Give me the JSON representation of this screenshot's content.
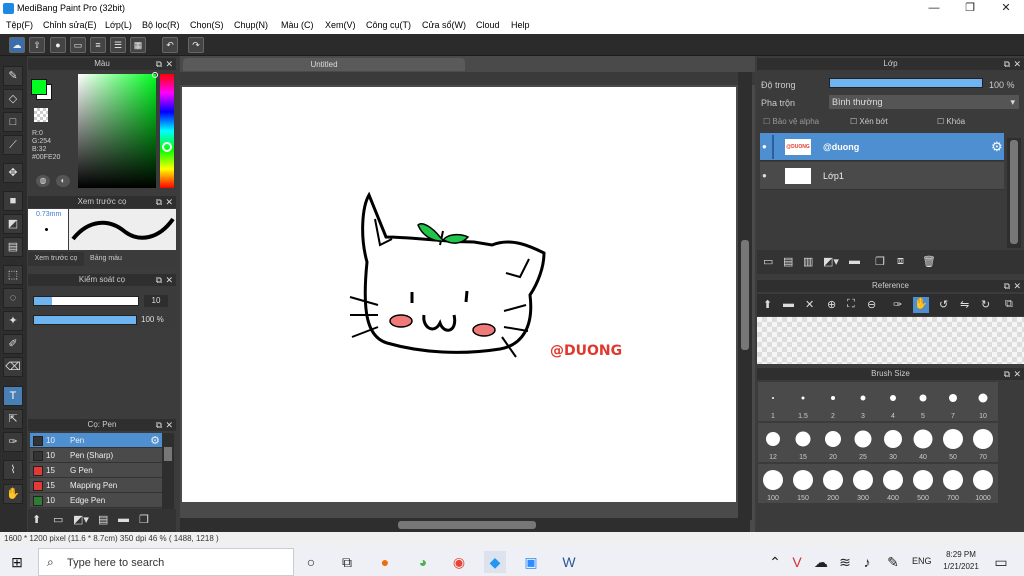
{
  "window": {
    "title": "MediBang Paint Pro (32bit)",
    "minimize": "—",
    "maximize": "❐",
    "close": "✕"
  },
  "menu": [
    "Tệp(F)",
    "Chỉnh sửa(E)",
    "Lớp(L)",
    "Bộ lọc(R)",
    "Chọn(S)",
    "Chụp(N)",
    "Màu (C)",
    "Xem(V)",
    "Công cụ(T)",
    "Cửa sổ(W)",
    "Cloud",
    "Help"
  ],
  "color_panel": {
    "title": "Màu",
    "r": "R:0",
    "g": "G:254",
    "b": "B:32",
    "hex": "#00FE20",
    "fg": "#00fe20",
    "bg": "#ffffff"
  },
  "brush_preview": {
    "title": "Xem trước cọ",
    "size": "0.73mm",
    "tab1": "Xem trước cọ",
    "tab2": "Bảng màu"
  },
  "brush_control": {
    "title": "Kiểm soát cọ",
    "size": "10",
    "opacity": "100 %",
    "opacity_fraction": 1.0
  },
  "brush_list": {
    "title": "Cọ: Pen",
    "items": [
      {
        "size": "10",
        "name": "Pen",
        "color": "#333333"
      },
      {
        "size": "10",
        "name": "Pen (Sharp)",
        "color": "#333333"
      },
      {
        "size": "15",
        "name": "G Pen",
        "color": "#e53935"
      },
      {
        "size": "15",
        "name": "Mapping Pen",
        "color": "#e53935"
      },
      {
        "size": "10",
        "name": "Edge Pen",
        "color": "#2e7d32"
      }
    ]
  },
  "canvas": {
    "tab": "Untitled",
    "signature": "@DUONG"
  },
  "layer_panel": {
    "title": "Lớp",
    "opacity_label": "Độ trong",
    "opacity": "100 %",
    "opacity_fraction": 1.0,
    "blend_label": "Pha trộn",
    "blend": "Bình thường",
    "protect_alpha": "Bảo vệ alpha",
    "clip": "Xén bớt",
    "lock": "Khóa",
    "layers": [
      {
        "name": "@duong",
        "thumb": "@DUONG"
      },
      {
        "name": "Lớp1",
        "thumb": ""
      }
    ]
  },
  "reference": {
    "title": "Reference"
  },
  "brush_size": {
    "title": "Brush Size",
    "sizes": [
      "1",
      "1.5",
      "2",
      "3",
      "4",
      "5",
      "7",
      "10",
      "12",
      "15",
      "20",
      "25",
      "30",
      "40",
      "50",
      "70",
      "100",
      "150",
      "200",
      "300",
      "400",
      "500",
      "700",
      "1000"
    ]
  },
  "status": {
    "text": "1600 * 1200 pixel   (11.6 * 8.7cm)   350 dpi   46 %   ( 1488, 1218 )"
  },
  "taskbar": {
    "search": "Type here to search",
    "lang": "ENG",
    "time": "8:29 PM",
    "date": "1/21/2021"
  }
}
